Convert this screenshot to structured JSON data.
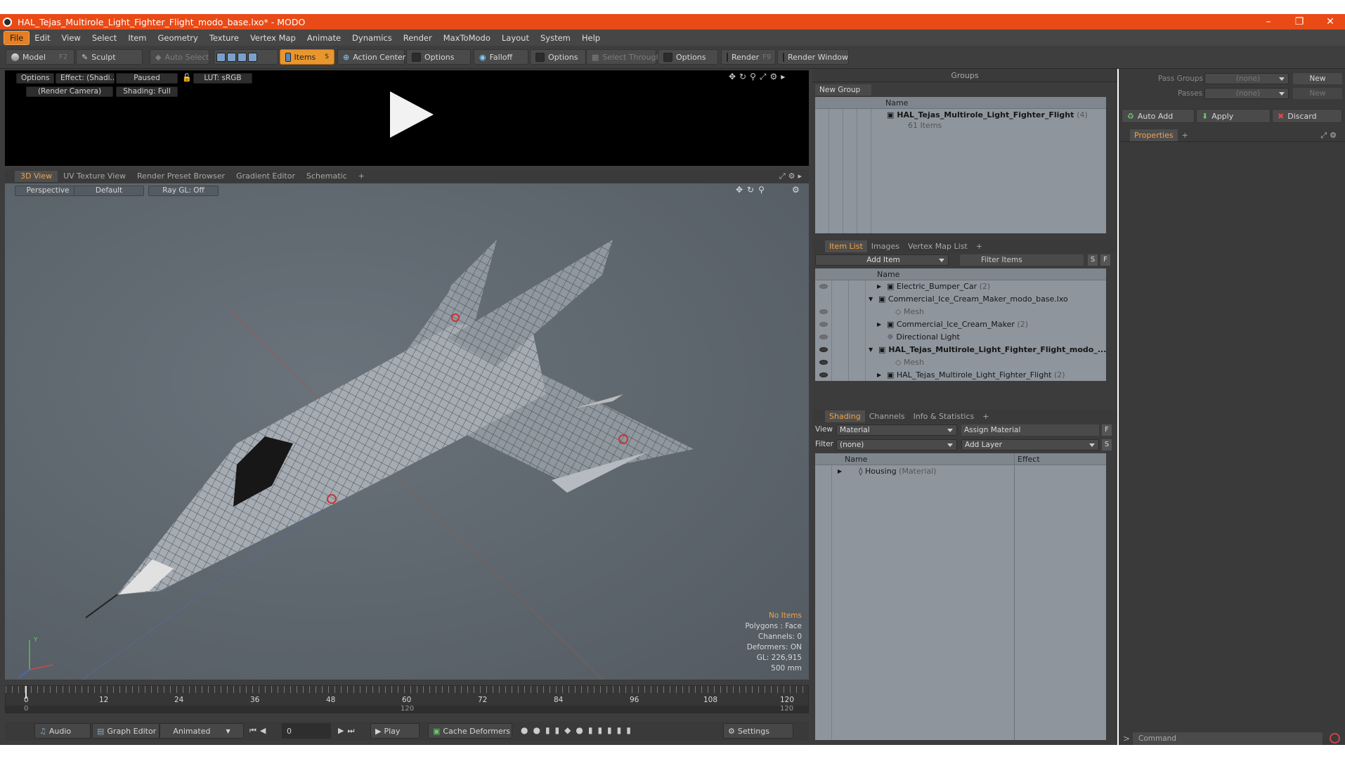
{
  "window": {
    "title": "HAL_Tejas_Multirole_Light_Fighter_Flight_modo_base.lxo* - MODO"
  },
  "menu": [
    "File",
    "Edit",
    "View",
    "Select",
    "Item",
    "Geometry",
    "Texture",
    "Vertex Map",
    "Animate",
    "Dynamics",
    "Render",
    "MaxToModo",
    "Layout",
    "System",
    "Help"
  ],
  "toolbar": {
    "model": "Model",
    "model_key": "F2",
    "sculpt": "Sculpt",
    "auto_select": "Auto Select",
    "items": "Items",
    "items_key": "S",
    "action_center": "Action Center",
    "options1": "Options",
    "falloff": "Falloff",
    "options2": "Options",
    "select_through": "Select Through",
    "options3": "Options",
    "render": "Render",
    "render_key": "F9",
    "render_window": "Render Window"
  },
  "preview": {
    "options": "Options",
    "effect": "Effect: (Shadi...",
    "paused": "Paused",
    "lut": "LUT: sRGB",
    "camera": "(Render Camera)",
    "shading": "Shading: Full"
  },
  "viewport_tabs": [
    "3D View",
    "UV Texture View",
    "Render Preset Browser",
    "Gradient Editor",
    "Schematic",
    "+"
  ],
  "viewport": {
    "perspective": "Perspective",
    "default": "Default",
    "raygl": "Ray GL: Off",
    "axis_y": "Y",
    "stats": [
      "No Items",
      "Polygons : Face",
      "Channels: 0",
      "Deformers: ON",
      "GL: 226,915",
      "500 mm"
    ]
  },
  "timeline": {
    "ticks_top": [
      "0",
      "12",
      "24",
      "36",
      "48",
      "60",
      "72",
      "84",
      "96",
      "108",
      "120"
    ],
    "ticks_bottom": [
      "0",
      "120",
      "120"
    ]
  },
  "bottom": {
    "audio": "Audio",
    "graph_editor": "Graph Editor",
    "animated": "Animated",
    "frame": "0",
    "play": "Play",
    "cache_deformers": "Cache Deformers",
    "settings": "Settings"
  },
  "groups": {
    "title": "Groups",
    "new_group": "New Group",
    "col_name": "Name",
    "row_name": "HAL_Tejas_Multirole_Light_Fighter_Flight",
    "row_count": "(4)",
    "row_items": "61 Items"
  },
  "item_list": {
    "tabs": [
      "Item List",
      "Images",
      "Vertex Map List",
      "+"
    ],
    "add_item": "Add Item",
    "filter_items": "Filter Items",
    "s": "S",
    "f": "F",
    "col_name": "Name",
    "rows": [
      {
        "label": "Electric_Bumper_Car",
        "count": "(2)"
      },
      {
        "label": "Commercial_Ice_Cream_Maker_modo_base.lxo",
        "count": ""
      },
      {
        "label": "Mesh",
        "count": ""
      },
      {
        "label": "Commercial_Ice_Cream_Maker",
        "count": "(2)"
      },
      {
        "label": "Directional Light",
        "count": ""
      },
      {
        "label": "HAL_Tejas_Multirole_Light_Fighter_Flight_modo_...",
        "count": ""
      },
      {
        "label": "Mesh",
        "count": ""
      },
      {
        "label": "HAL_Tejas_Multirole_Light_Fighter_Flight",
        "count": "(2)"
      }
    ]
  },
  "shading": {
    "tabs": [
      "Shading",
      "Channels",
      "Info & Statistics",
      "+"
    ],
    "view_label": "View",
    "view_value": "Material",
    "assign_material": "Assign Material",
    "f": "F",
    "filter_label": "Filter",
    "filter_value": "(none)",
    "add_layer": "Add Layer",
    "s": "S",
    "col_name": "Name",
    "col_effect": "Effect",
    "row_name": "Housing",
    "row_type": "(Material)"
  },
  "pass": {
    "pass_groups_label": "Pass Groups",
    "pass_groups_value": "(none)",
    "new": "New",
    "passes_label": "Passes",
    "passes_value": "(none)",
    "new2": "New",
    "auto_add": "Auto Add",
    "apply": "Apply",
    "discard": "Discard",
    "properties_tab": "Properties",
    "plus": "+"
  },
  "command": {
    "placeholder": "Command"
  },
  "colors": {
    "title_bar": "#ea4a16",
    "accent": "#e9962f",
    "active_tab_text": "#f0a34a"
  }
}
